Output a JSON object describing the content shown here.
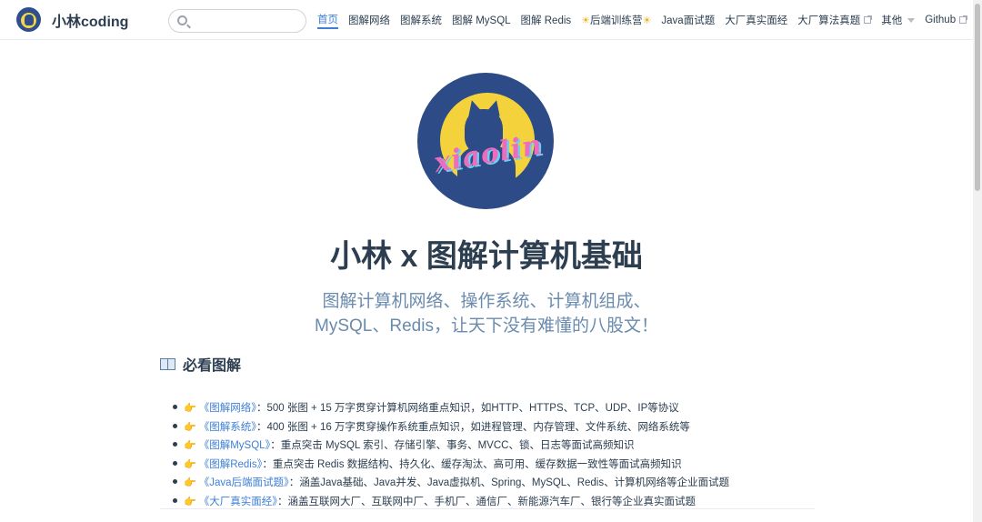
{
  "site": {
    "name": "小林coding"
  },
  "search": {
    "placeholder": "",
    "value": ""
  },
  "nav": {
    "items": [
      {
        "label": "首页",
        "active": true
      },
      {
        "label": "图解网络"
      },
      {
        "label": "图解系统"
      },
      {
        "label": "图解 MySQL"
      },
      {
        "label": "图解 Redis"
      },
      {
        "label": "后端训练营",
        "decor": "☀"
      },
      {
        "label": "Java面试题"
      },
      {
        "label": "大厂真实面经"
      },
      {
        "label": "大厂算法真题",
        "external": true
      },
      {
        "label": "其他",
        "dropdown": true
      },
      {
        "label": "Github",
        "external": true
      }
    ]
  },
  "hero": {
    "logo_text": "xiaolin",
    "title": "小林 x 图解计算机基础",
    "desc_line1": "图解计算机网络、操作系统、计算机组成、",
    "desc_line2": "MySQL、Redis，让天下没有难懂的八股文！"
  },
  "section": {
    "title": "必看图解",
    "items": [
      {
        "link": "《图解网络》",
        "sep": "：",
        "text": "500 张图 + 15 万字贯穿计算机网络重点知识，如HTTP、HTTPS、TCP、UDP、IP等协议"
      },
      {
        "link": "《图解系统》",
        "sep": "：",
        "text": "400 张图 + 16 万字贯穿操作系统重点知识，如进程管理、内存管理、文件系统、网络系统等"
      },
      {
        "link": "《图解MySQL》",
        "sep": "：",
        "text": "重点突击 MySQL 索引、存储引擎、事务、MVCC、锁、日志等面试高频知识"
      },
      {
        "link": "《图解Redis》",
        "sep": "：",
        "text": "重点突击 Redis 数据结构、持久化、缓存淘汰、高可用、缓存数据一致性等面试高频知识"
      },
      {
        "link": "《Java后端面试题》",
        "sep": "：",
        "text": "涵盖Java基础、Java并发、Java虚拟机、Spring、MySQL、Redis、计算机网络等企业面试题"
      },
      {
        "link": "《大厂真实面经》",
        "sep": "：",
        "text": "涵盖互联网大厂、互联网中厂、手机厂、通信厂、新能源汽车厂、银行等企业真实面试题"
      }
    ]
  },
  "colors": {
    "accent": "#3e7fd8",
    "desc": "#6a8bad",
    "text": "#2c3e50"
  }
}
